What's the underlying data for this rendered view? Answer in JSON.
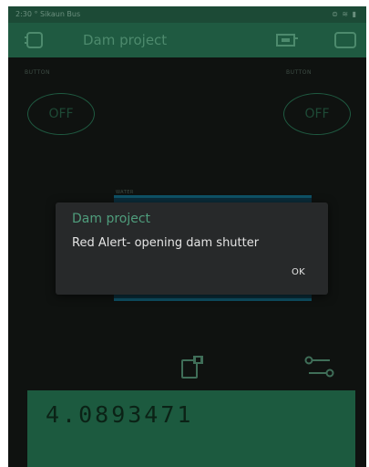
{
  "status_bar": {
    "time": "2:30 ° Sikaun Bus",
    "icons": "⊜ ≋ ▮"
  },
  "app_bar": {
    "title": "Dam project",
    "icons": [
      "project-icon",
      "device-icon",
      "widget-box-icon"
    ]
  },
  "widgets": {
    "left_button": {
      "label": "BUTTON",
      "state": "OFF"
    },
    "right_button": {
      "label": "BUTTON",
      "state": "OFF"
    },
    "water": {
      "label": "WATER"
    },
    "value_display": {
      "value": "4.0893471"
    }
  },
  "dialog": {
    "title": "Dam project",
    "message": "Red Alert- opening dam shutter",
    "ok_label": "OK"
  },
  "colors": {
    "background": "#0f1210",
    "app_bar": "#1f5a41",
    "accent": "#4f9d7c",
    "dialog_bg": "#27292a",
    "value_display_bg": "#1c5a3f",
    "gauge_bg": "#0b2c3a"
  }
}
